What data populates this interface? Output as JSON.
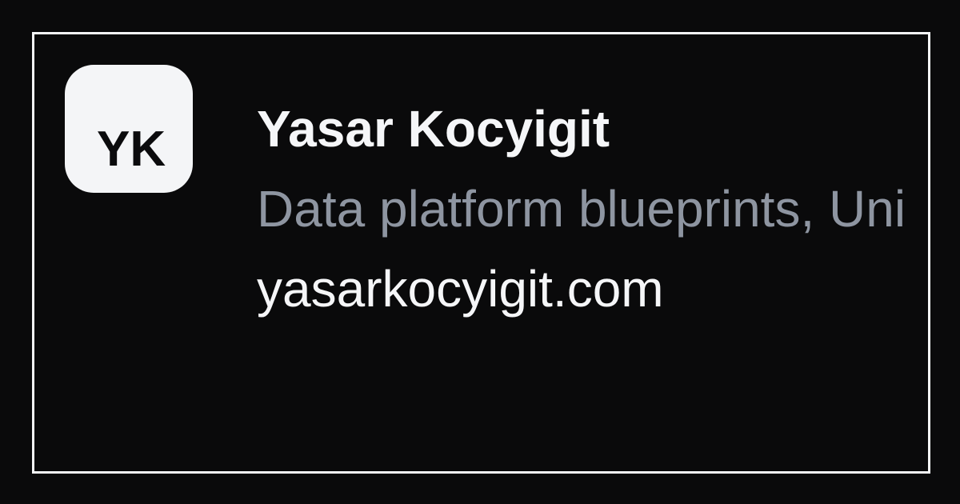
{
  "card": {
    "avatar_initials": "YK",
    "name": "Yasar Kocyigit",
    "tagline": "Data platform blueprints, Uni",
    "website": "yasarkocyigit.com"
  },
  "colors": {
    "background": "#0a0a0b",
    "border": "#f5f6f8",
    "avatar_background": "#f4f5f7",
    "primary_text": "#f5f6f8",
    "secondary_text": "#8e95a1"
  }
}
